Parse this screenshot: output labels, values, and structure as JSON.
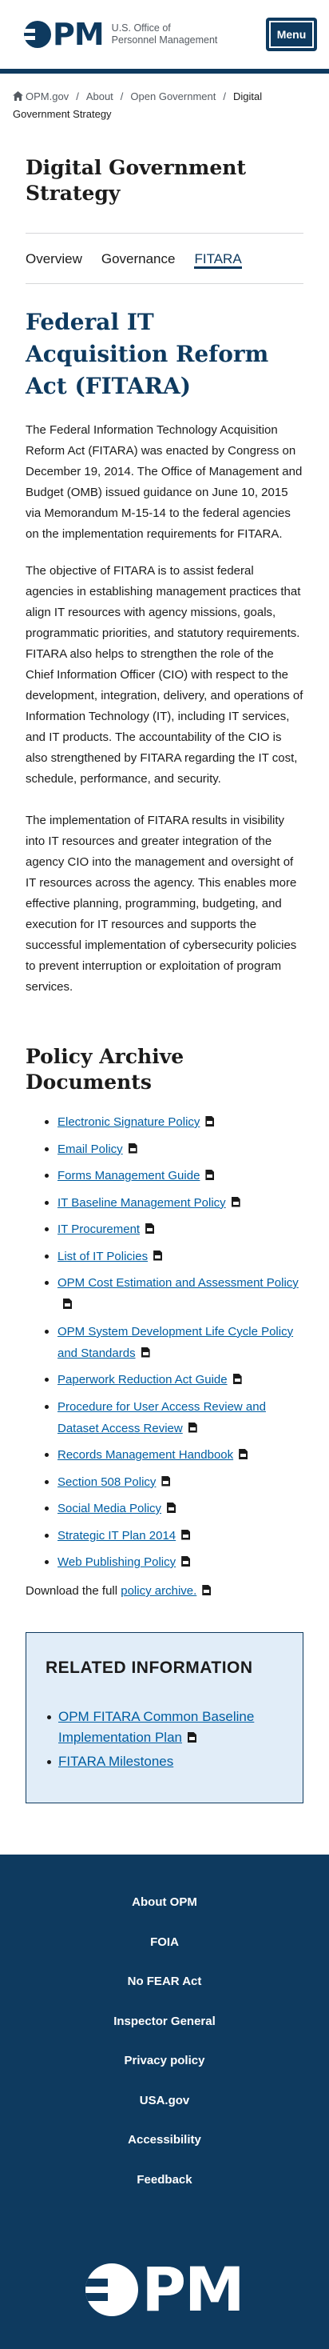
{
  "header": {
    "logo_letters": "PM",
    "logo_text_line1": "U.S. Office of",
    "logo_text_line2": "Personnel Management",
    "menu_label": "Menu"
  },
  "breadcrumb": {
    "items": [
      "OPM.gov",
      "About",
      "Open Government"
    ],
    "current": "Digital Government Strategy",
    "separator": "/"
  },
  "page_title": "Digital Government Strategy",
  "tabs": [
    {
      "label": "Overview",
      "active": false
    },
    {
      "label": "Governance",
      "active": false
    },
    {
      "label": "FITARA",
      "active": true
    }
  ],
  "content": {
    "title": "Federal IT Acquisition Reform Act (FITARA)",
    "paragraphs": [
      "The Federal Information Technology Acquisition Reform Act (FITARA) was enacted by Congress on December 19, 2014.  The Office of Management and Budget (OMB) issued guidance on June 10, 2015 via Memorandum M-15-14 to the federal agencies on the implementation requirements for FITARA.",
      "The objective of FITARA is to assist federal agencies in establishing management practices that align IT resources with agency missions, goals, programmatic priorities, and statutory requirements. FITARA also helps to strengthen the role of the Chief Information Officer (CIO) with respect to the development, integration, delivery, and operations of Information Technology (IT), including IT services, and IT products.  The accountability of the CIO is also strengthened by FITARA regarding the IT cost, schedule, performance, and security.",
      "The implementation of FITARA results in visibility into IT resources and greater integration of the agency CIO into the management and oversight of IT resources across the agency. This enables more effective planning, programming, budgeting, and execution for IT resources and supports the successful implementation of cybersecurity policies to prevent interruption or exploitation of program services."
    ]
  },
  "archive": {
    "title": "Policy Archive Documents",
    "documents": [
      "Electronic Signature Policy",
      "Email Policy",
      "Forms Management Guide",
      "IT Baseline Management Policy",
      "IT Procurement",
      "List of IT Policies",
      "OPM Cost Estimation and Assessment Policy",
      "OPM System Development Life Cycle Policy and Standards",
      "Paperwork Reduction Act Guide",
      "Procedure for User Access Review and Dataset Access Review",
      "Records Management Handbook",
      "Section 508 Policy",
      "Social Media Policy",
      "Strategic IT Plan 2014",
      "Web Publishing Policy"
    ],
    "download_prefix": "Download the full ",
    "download_link": "policy archive."
  },
  "related": {
    "title": "RELATED INFORMATION",
    "links": [
      "OPM FITARA Common Baseline Implementation Plan",
      "FITARA Milestones"
    ]
  },
  "footer": {
    "links": [
      "About OPM",
      "FOIA",
      "No FEAR Act",
      "Inspector General",
      "Privacy policy",
      "USA.gov",
      "Accessibility",
      "Feedback"
    ],
    "logo_letters": "PM"
  },
  "colors": {
    "brand_navy": "#0e3a5f",
    "link_blue": "#005ea2",
    "related_bg": "#e1edf8"
  },
  "icons": {
    "breadcrumb_home": "home-icon",
    "document_type": "pdf-icon"
  }
}
